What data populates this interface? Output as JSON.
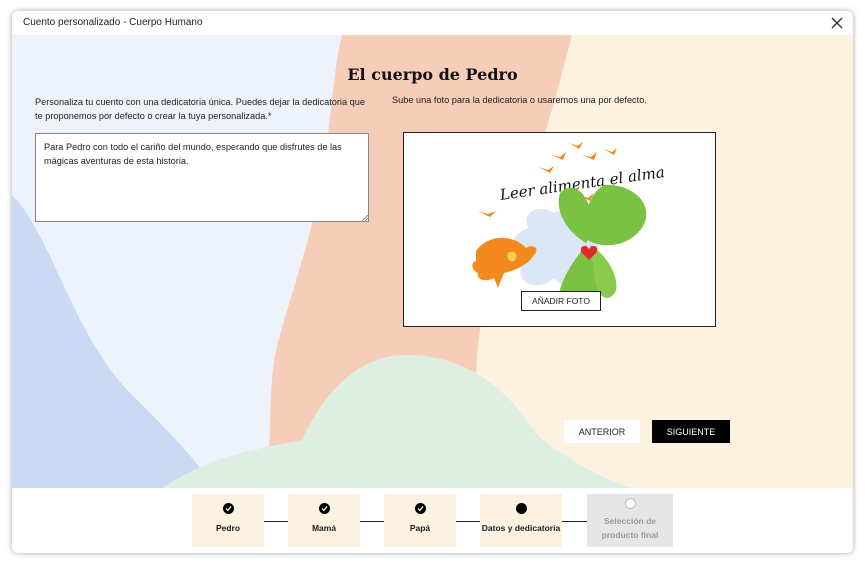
{
  "window": {
    "title": "Cuento personalizado - Cuerpo Humano"
  },
  "page": {
    "heading": "El cuerpo de Pedro",
    "intro_left": "Personaliza tu cuento con una dedicatoria única. Puedes dejar la dedicatoria que te proponemos por defecto o crear la tuya personalizada.*",
    "intro_right": "Sube una foto para la dedicatoria o usaremos una por defecto.",
    "dedication_text": "Para Pedro con todo el cariño del mundo, esperando que disfrutes de las mágicas aventuras de esta historia.",
    "image_caption": "Leer alimenta el alma",
    "add_photo_label": "AÑADIR FOTO",
    "prev_label": "ANTERIOR",
    "next_label": "SIGUIENTE"
  },
  "steps": [
    {
      "label": "Pedro",
      "state": "done"
    },
    {
      "label": "Mamá",
      "state": "done"
    },
    {
      "label": "Papá",
      "state": "done"
    },
    {
      "label": "Datos y dedicatoria",
      "state": "current"
    },
    {
      "label": "Selección de producto final",
      "state": "disabled"
    }
  ],
  "colors": {
    "bg_blue": "#c9daf2",
    "bg_pale_blue": "#eef3fb",
    "bg_peach": "#f5cdb8",
    "bg_cream": "#fdf1e0",
    "bg_mint": "#dfeee2",
    "bird_orange": "#f28a1e",
    "leaf_green": "#7cc242",
    "heart_red": "#e02a2a",
    "step_bg": "#fdf1e2"
  }
}
